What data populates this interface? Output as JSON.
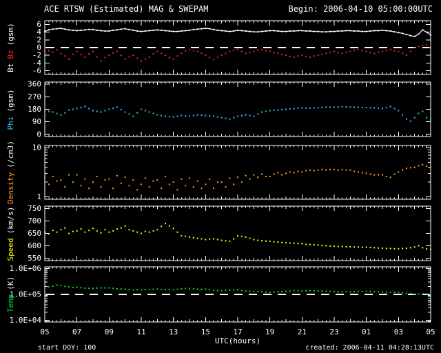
{
  "header": {
    "title": "ACE RTSW (Estimated) MAG & SWEPAM",
    "begin_label": "Begin: 2006-04-10 05:00:00UTC"
  },
  "footer": {
    "start_doy": "start DOY: 100",
    "created": "created: 2006-04-11 04:28:13UTC"
  },
  "colors": {
    "background": "#000000",
    "frame": "#ffffff",
    "bt": "#ffffff",
    "bz": "#ff2222",
    "phi": "#2fc4f4",
    "density": "#ffa028",
    "speed": "#ffff00",
    "temp": "#00e033"
  },
  "chart_data": {
    "type": "scatter",
    "title": "ACE RTSW (Estimated) MAG & SWEPAM",
    "x_label": "UTC(hours)",
    "x_tick_labels": [
      "05",
      "07",
      "09",
      "11",
      "13",
      "15",
      "17",
      "19",
      "21",
      "23",
      "01",
      "03",
      "05"
    ],
    "x_hours_start": 5,
    "x_hours_end": 29,
    "x_step_hours": 0.25,
    "panels": [
      {
        "id": "bt-bz",
        "ylabel_parts": [
          {
            "text": "Bt",
            "color": "#ffffff"
          },
          {
            "text": "Bz",
            "color": "#ff2222"
          },
          {
            "text": "(gsm)",
            "color": "#ffffff"
          }
        ],
        "scale": "linear",
        "ymin": -7,
        "ymax": 7,
        "yticks": [
          {
            "v": 6,
            "t": "6"
          },
          {
            "v": 4,
            "t": "4"
          },
          {
            "v": 2,
            "t": "2"
          },
          {
            "v": 0,
            "t": "0"
          },
          {
            "v": -2,
            "t": "-2"
          },
          {
            "v": -4,
            "t": "-4"
          },
          {
            "v": -6,
            "t": "-6"
          }
        ],
        "ref_line": 0,
        "series": [
          {
            "name": "Bt",
            "color": "#ffffff",
            "style": "line",
            "values": [
              4.2,
              4.6,
              4.8,
              4.9,
              5.0,
              4.8,
              4.6,
              4.5,
              4.4,
              4.5,
              4.6,
              4.7,
              4.7,
              4.5,
              4.4,
              4.3,
              4.3,
              4.5,
              4.6,
              4.8,
              4.9,
              4.7,
              4.5,
              4.3,
              4.2,
              4.3,
              4.4,
              4.5,
              4.6,
              4.5,
              4.4,
              4.3,
              4.2,
              4.2,
              4.3,
              4.4,
              4.5,
              4.7,
              4.8,
              4.9,
              5.0,
              4.9,
              4.7,
              4.5,
              4.4,
              4.3,
              4.2,
              4.3,
              4.5,
              4.4,
              4.3,
              4.2,
              4.1,
              4.1,
              4.2,
              4.3,
              4.4,
              4.4,
              4.3,
              4.2,
              4.2,
              4.3,
              4.3,
              4.4,
              4.4,
              4.3,
              4.3,
              4.2,
              4.2,
              4.1,
              4.1,
              4.2,
              4.2,
              4.3,
              4.3,
              4.4,
              4.4,
              4.3,
              4.3,
              4.2,
              4.2,
              4.3,
              4.4,
              4.4,
              4.5,
              4.4,
              4.3,
              4.1,
              3.9,
              3.7,
              3.4,
              3.1,
              2.9,
              3.5,
              4.6,
              4.0,
              3.3
            ]
          },
          {
            "name": "Bz",
            "color": "#ff2222",
            "style": "dots",
            "values": [
              -0.4,
              -0.8,
              -1.2,
              -0.6,
              -1.5,
              -2.2,
              -3.0,
              -1.8,
              -1.0,
              -1.8,
              -2.5,
              -1.6,
              -1.0,
              -2.4,
              -3.5,
              -2.6,
              -2.0,
              -1.4,
              -1.0,
              -2.0,
              -3.0,
              -2.4,
              -2.0,
              -2.8,
              -3.5,
              -3.0,
              -2.5,
              -1.6,
              -1.0,
              -1.5,
              -2.0,
              -2.6,
              -3.0,
              -2.2,
              -1.5,
              -0.9,
              -0.5,
              -0.8,
              -1.0,
              -1.5,
              -2.0,
              -2.6,
              -3.1,
              -2.5,
              -2.0,
              -1.5,
              -1.0,
              -0.7,
              -0.5,
              -1.0,
              -1.5,
              -1.2,
              -1.0,
              -0.7,
              -0.5,
              -0.8,
              -1.0,
              -1.3,
              -1.5,
              -1.8,
              -2.0,
              -2.3,
              -2.5,
              -2.2,
              -2.0,
              -2.3,
              -2.5,
              -2.2,
              -2.0,
              -1.8,
              -1.5,
              -1.2,
              -1.0,
              -1.3,
              -1.5,
              -1.2,
              -1.0,
              -0.7,
              -0.5,
              -0.8,
              -1.0,
              -1.3,
              -1.5,
              -1.2,
              -1.0,
              -0.7,
              -0.5,
              -0.8,
              -1.0,
              -1.5,
              -2.0,
              -1.0,
              0.0,
              0.3,
              0.5,
              0.7,
              0.8
            ]
          }
        ]
      },
      {
        "id": "phi",
        "ylabel_parts": [
          {
            "text": "Phi",
            "color": "#2fc4f4"
          },
          {
            "text": "(gsm)",
            "color": "#ffffff"
          }
        ],
        "scale": "linear",
        "ymin": -15,
        "ymax": 375,
        "yticks": [
          {
            "v": 360,
            "t": "360"
          },
          {
            "v": 270,
            "t": "270"
          },
          {
            "v": 180,
            "t": "180"
          },
          {
            "v": 90,
            "t": "90"
          },
          {
            "v": 0,
            "t": "0"
          }
        ],
        "ref_line": null,
        "series": [
          {
            "name": "Phi",
            "color": "#2fc4f4",
            "style": "dots",
            "values": [
              170,
              165,
              160,
              150,
              140,
              155,
              175,
              180,
              185,
              192,
              200,
              185,
              170,
              165,
              160,
              170,
              180,
              188,
              195,
              178,
              160,
              145,
              130,
              155,
              180,
              170,
              160,
              150,
              140,
              135,
              130,
              128,
              125,
              130,
              135,
              132,
              130,
              135,
              140,
              138,
              135,
              132,
              130,
              125,
              120,
              115,
              110,
              120,
              130,
              135,
              140,
              135,
              130,
              145,
              160,
              165,
              170,
              173,
              175,
              178,
              180,
              183,
              185,
              188,
              190,
              189,
              188,
              190,
              192,
              193,
              195,
              195,
              195,
              196,
              198,
              197,
              196,
              195,
              195,
              193,
              192,
              191,
              190,
              188,
              185,
              192,
              200,
              185,
              170,
              140,
              110,
              95,
              120,
              150,
              165,
              120,
              105
            ]
          }
        ]
      },
      {
        "id": "density",
        "ylabel_parts": [
          {
            "text": "Density",
            "color": "#ffa028"
          },
          {
            "text": "(/cm3)",
            "color": "#ffffff"
          }
        ],
        "scale": "log",
        "ymin": 0.9,
        "ymax": 11,
        "yticks": [
          {
            "v": 10,
            "t": "10"
          },
          {
            "v": 1,
            "t": "1"
          }
        ],
        "ref_line": null,
        "series": [
          {
            "name": "Density",
            "color": "#ffa028",
            "style": "dots",
            "values": [
              2.5,
              1.8,
              2.6,
              2.1,
              2.2,
              1.6,
              2.8,
              2.0,
              2.8,
              1.7,
              2.3,
              1.5,
              2.0,
              2.6,
              1.6,
              2.2,
              2.3,
              1.5,
              2.7,
              1.9,
              2.5,
              1.7,
              2.2,
              1.4,
              1.8,
              2.4,
              1.6,
              2.1,
              2.2,
              1.5,
              2.6,
              1.8,
              2.0,
              1.4,
              2.3,
              1.7,
              2.4,
              1.6,
              2.1,
              1.5,
              1.8,
              2.3,
              1.5,
              2.0,
              2.0,
              1.6,
              2.4,
              1.8,
              2.5,
              2.0,
              2.7,
              2.3,
              2.8,
              2.5,
              2.9,
              2.6,
              2.6,
              2.9,
              3.1,
              2.8,
              3.0,
              3.2,
              3.1,
              3.3,
              3.2,
              3.4,
              3.5,
              3.4,
              3.5,
              3.6,
              3.5,
              3.6,
              3.6,
              3.5,
              3.6,
              3.5,
              3.5,
              3.3,
              3.2,
              3.1,
              3.0,
              2.9,
              2.8,
              2.8,
              2.8,
              2.6,
              2.5,
              2.9,
              3.2,
              3.5,
              3.8,
              3.9,
              4.0,
              4.3,
              4.5,
              4.2,
              4.0
            ]
          }
        ]
      },
      {
        "id": "speed",
        "ylabel_parts": [
          {
            "text": "Speed",
            "color": "#ffff00"
          },
          {
            "text": "(km/s)",
            "color": "#ffffff"
          }
        ],
        "scale": "linear",
        "ymin": 540,
        "ymax": 760,
        "yticks": [
          {
            "v": 750,
            "t": "750"
          },
          {
            "v": 700,
            "t": "700"
          },
          {
            "v": 650,
            "t": "650"
          },
          {
            "v": 600,
            "t": "600"
          },
          {
            "v": 550,
            "t": "550"
          }
        ],
        "ref_line": null,
        "series": [
          {
            "name": "Speed",
            "color": "#ffff00",
            "style": "dots",
            "values": [
              655,
              648,
              662,
              655,
              665,
              672,
              650,
              658,
              660,
              668,
              655,
              662,
              670,
              660,
              652,
              665,
              655,
              660,
              668,
              672,
              680,
              665,
              660,
              655,
              650,
              658,
              655,
              660,
              665,
              678,
              690,
              680,
              670,
              655,
              640,
              638,
              635,
              632,
              630,
              628,
              625,
              627,
              628,
              625,
              622,
              620,
              618,
              628,
              640,
              638,
              635,
              630,
              625,
              622,
              620,
              619,
              618,
              616,
              615,
              613,
              612,
              611,
              610,
              609,
              608,
              606,
              605,
              604,
              603,
              601,
              600,
              599,
              598,
              597,
              597,
              596,
              596,
              595,
              595,
              594,
              594,
              593,
              592,
              591,
              590,
              589,
              589,
              588,
              588,
              589,
              590,
              592,
              595,
              600,
              592,
              588,
              585
            ]
          }
        ]
      },
      {
        "id": "temp",
        "ylabel_parts": [
          {
            "text": "Temp",
            "color": "#00e033"
          },
          {
            "text": "(K)",
            "color": "#ffffff"
          }
        ],
        "scale": "log",
        "ymin": 8500,
        "ymax": 1175000,
        "yticks": [
          {
            "v": 1000000,
            "t": "1.0E+06"
          },
          {
            "v": 100000,
            "t": "1.0E+05"
          },
          {
            "v": 10000,
            "t": "1.0E+04"
          }
        ],
        "ref_line": 100000,
        "series": [
          {
            "name": "Temp",
            "color": "#00e033",
            "style": "dots",
            "values": [
              180000,
              195000,
              210000,
              230000,
              220000,
              205000,
              195000,
              185000,
              190000,
              182000,
              175000,
              172000,
              170000,
              175000,
              180000,
              178000,
              180000,
              172000,
              165000,
              162000,
              160000,
              155000,
              150000,
              152000,
              150000,
              153000,
              155000,
              158000,
              160000,
              155000,
              150000,
              152000,
              150000,
              158000,
              165000,
              170000,
              170000,
              165000,
              160000,
              158000,
              160000,
              152000,
              145000,
              142000,
              140000,
              142000,
              145000,
              148000,
              150000,
              143000,
              135000,
              132000,
              130000,
              128000,
              125000,
              122000,
              120000,
              123000,
              126000,
              128000,
              130000,
              135000,
              140000,
              137000,
              135000,
              137000,
              140000,
              137000,
              135000,
              133000,
              132000,
              131000,
              130000,
              129000,
              128000,
              127000,
              125000,
              127000,
              130000,
              128000,
              130000,
              128000,
              126000,
              126000,
              125000,
              123000,
              122000,
              121000,
              120000,
              115000,
              110000,
              107000,
              100000,
              103000,
              105000,
              102000,
              100000
            ]
          }
        ]
      }
    ]
  }
}
